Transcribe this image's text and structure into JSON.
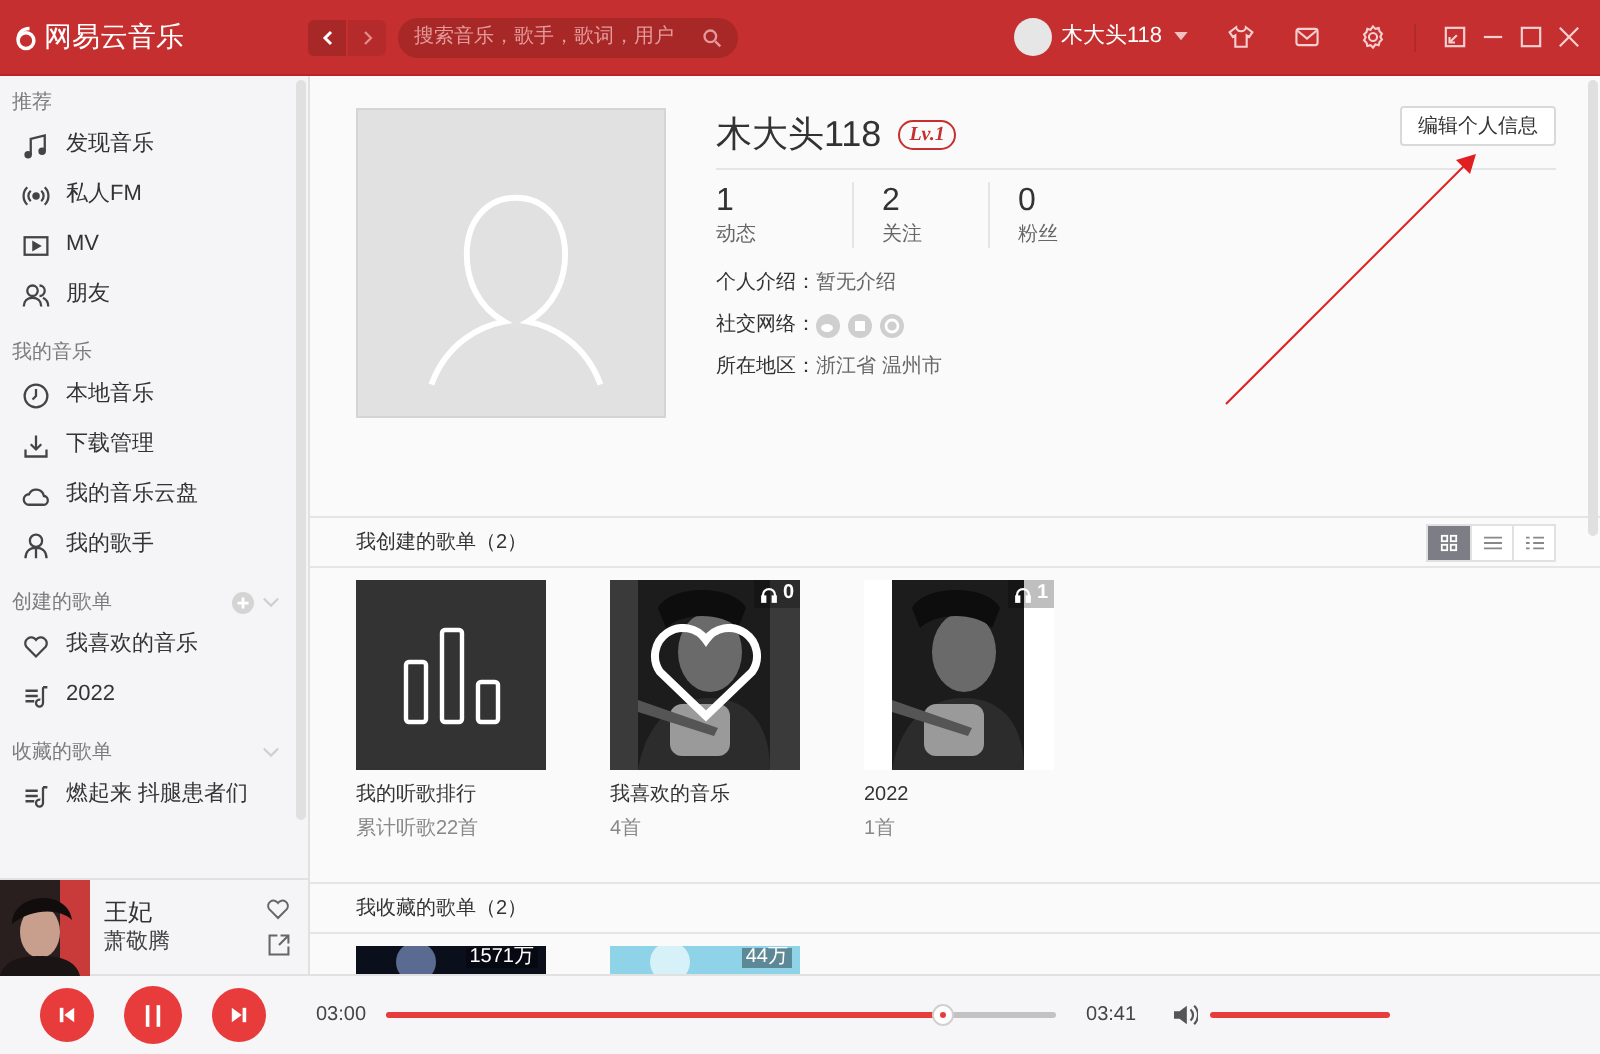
{
  "header": {
    "logo": "网易云音乐",
    "search": {
      "placeholder": "搜索音乐，歌手，歌词，用户"
    },
    "user": {
      "name": "木大头118"
    }
  },
  "sidebar": {
    "sections": [
      {
        "title": "推荐",
        "items": [
          {
            "label": "发现音乐",
            "selected": false
          },
          {
            "label": "私人FM",
            "selected": false
          },
          {
            "label": "MV",
            "selected": false
          },
          {
            "label": "朋友",
            "selected": false
          }
        ]
      },
      {
        "title": "我的音乐",
        "items": [
          {
            "label": "本地音乐",
            "selected": false
          },
          {
            "label": "下载管理",
            "selected": false
          },
          {
            "label": "我的音乐云盘",
            "selected": false
          },
          {
            "label": "我的歌手",
            "selected": false
          }
        ]
      },
      {
        "title": "创建的歌单",
        "addable": true,
        "items": [
          {
            "label": "我喜欢的音乐",
            "selected": false
          },
          {
            "label": "2022",
            "selected": false
          }
        ]
      },
      {
        "title": "收藏的歌单",
        "addable": false,
        "items": [
          {
            "label": "燃起来 抖腿患者们",
            "selected": false
          }
        ]
      }
    ]
  },
  "now_playing": {
    "song": "王妃",
    "artist": "萧敬腾"
  },
  "profile": {
    "name": "木大头118",
    "level": "Lv.1",
    "edit_button": "编辑个人信息",
    "stats": [
      {
        "value": "1",
        "label": "动态"
      },
      {
        "value": "2",
        "label": "关注"
      },
      {
        "value": "0",
        "label": "粉丝"
      }
    ],
    "info": [
      {
        "kind": "text",
        "label": "个人介绍：",
        "value": "暂无介绍"
      },
      {
        "kind": "social",
        "label": "社交网络："
      },
      {
        "kind": "text",
        "label": "所在地区：",
        "value": "浙江省 温州市"
      }
    ]
  },
  "playlist_sections": [
    {
      "title": "我创建的歌单（2）",
      "views": [
        {
          "selected": true
        },
        {
          "selected": false
        },
        {
          "selected": false
        }
      ],
      "cards": [
        {
          "kind": "chart",
          "title": "我的听歌排行",
          "subtitle": "累计听歌22首"
        },
        {
          "kind": "liked",
          "title": "我喜欢的音乐",
          "subtitle": "4首",
          "play_count": "0"
        },
        {
          "kind": "picture",
          "title": "2022",
          "subtitle": "1首",
          "play_count": "1"
        }
      ]
    },
    {
      "title": "我收藏的歌单（2）",
      "cards": [
        {
          "kind": "night",
          "play_count": "1571万"
        },
        {
          "kind": "sky",
          "play_count": "44万"
        }
      ]
    }
  ],
  "player": {
    "elapsed": "03:00",
    "total": "03:41",
    "level": 0.83
  }
}
